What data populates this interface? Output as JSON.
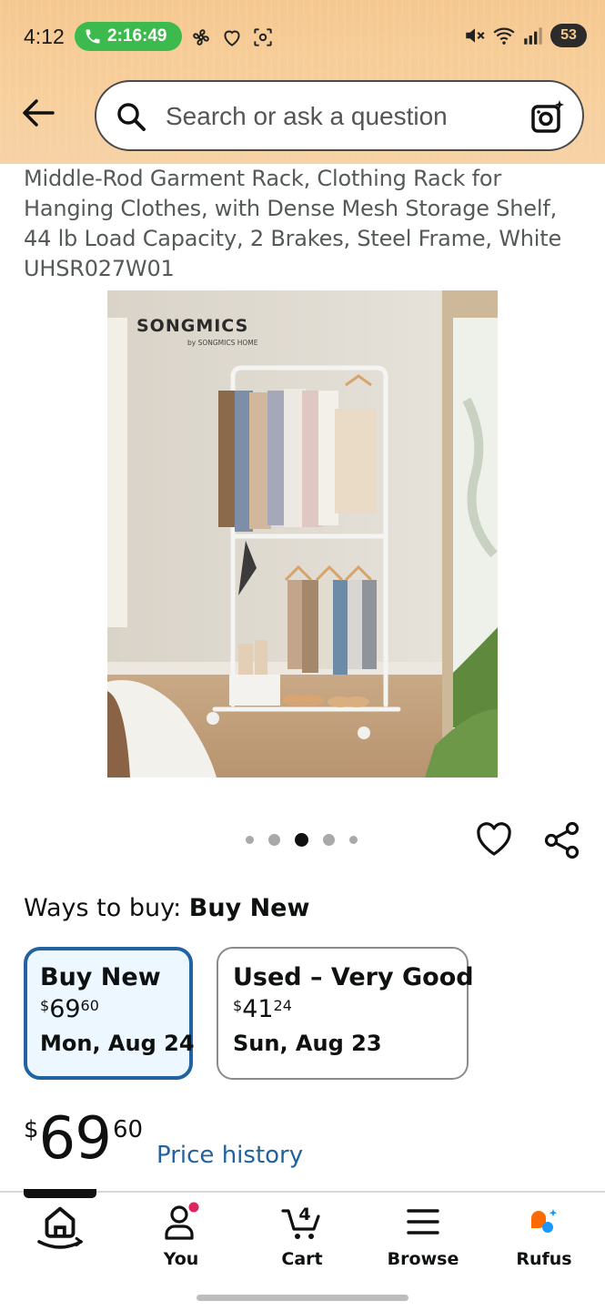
{
  "status_bar": {
    "time": "4:12",
    "call_duration": "2:16:49",
    "battery": "53"
  },
  "search": {
    "placeholder": "Search or ask a question"
  },
  "product": {
    "title": "Middle-Rod Garment Rack, Clothing Rack for Hanging Clothes, with Dense Mesh Storage Shelf, 44 lb Load Capacity, 2 Brakes, Steel Frame, White UHSR027W01",
    "image_brand": "SONGMICS",
    "image_brand_sub": "by SONGMICS HOME",
    "carousel_total": 5,
    "carousel_active_index": 2
  },
  "ways_to_buy": {
    "label": "Ways to buy: ",
    "selected": "Buy New"
  },
  "offers": [
    {
      "name": "Buy New",
      "price_currency": "$",
      "price_whole": "69",
      "price_fraction": "60",
      "delivery": "Mon, Aug 24",
      "selected": true
    },
    {
      "name": "Used – Very Good",
      "price_currency": "$",
      "price_whole": "41",
      "price_fraction": "24",
      "delivery": "Sun, Aug 23",
      "selected": false
    }
  ],
  "price": {
    "currency": "$",
    "whole": "69",
    "fraction": "60",
    "history_link": "Price history"
  },
  "bottom_nav": {
    "items": [
      {
        "label": "",
        "icon": "home-icon"
      },
      {
        "label": "You",
        "icon": "person-icon"
      },
      {
        "label": "Cart",
        "icon": "cart-icon",
        "badge": "4"
      },
      {
        "label": "Browse",
        "icon": "menu-icon"
      },
      {
        "label": "Rufus",
        "icon": "rufus-icon"
      }
    ]
  },
  "colors": {
    "header_bg": "#f7cf9c",
    "call_green": "#3dba4e",
    "selected_border": "#2162a1",
    "link_blue": "#2162a1",
    "notification_dot": "#e0245e",
    "rufus_orange": "#ff6a00",
    "rufus_blue": "#1a98ff"
  }
}
